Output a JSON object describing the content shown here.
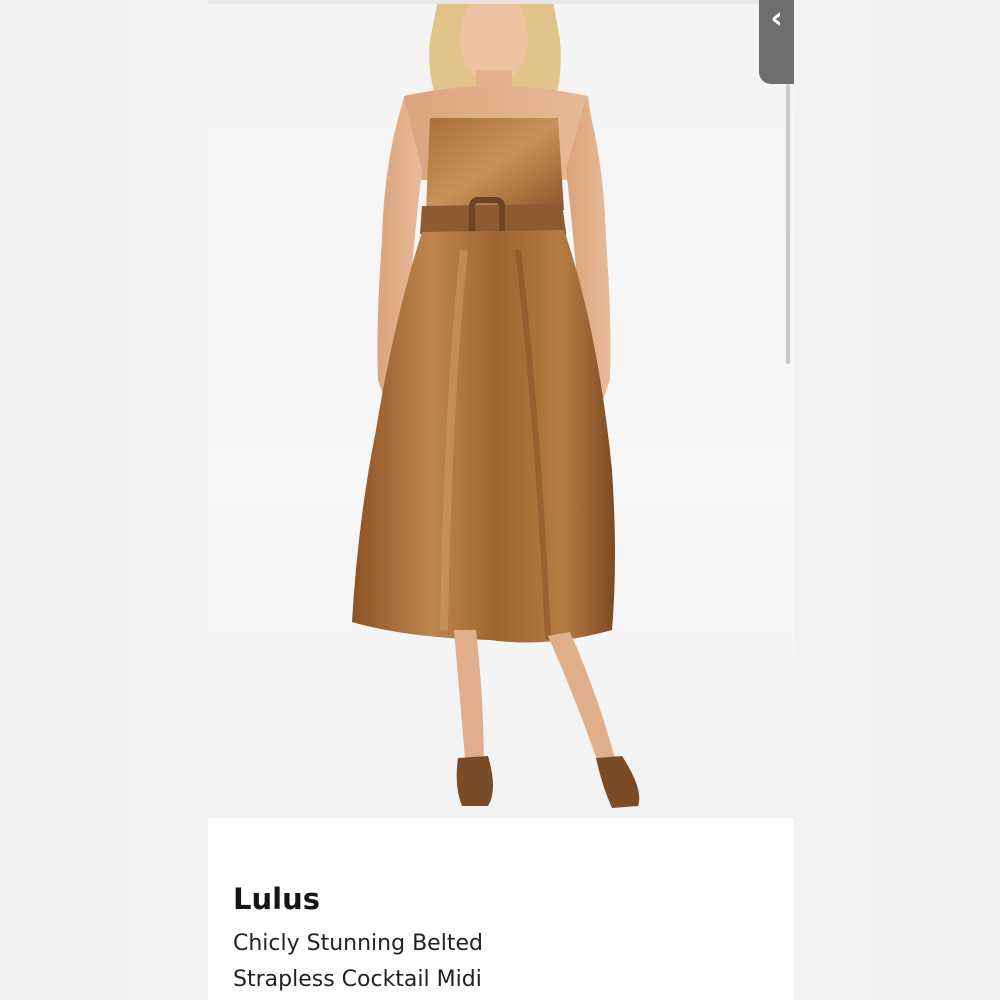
{
  "listing": {
    "brand": "Lulus",
    "title_lines": [
      "Chicly Stunning Belted",
      "Strapless Cocktail Midi"
    ]
  },
  "nav": {
    "back_icon": "chevron-left-icon"
  },
  "photo": {
    "subject": "model-in-bronze-dress"
  },
  "colors": {
    "dress": "#9a6232",
    "dress_highlight": "#c58d57",
    "tab_bg": "#6e6e6e",
    "text": "#151515"
  }
}
